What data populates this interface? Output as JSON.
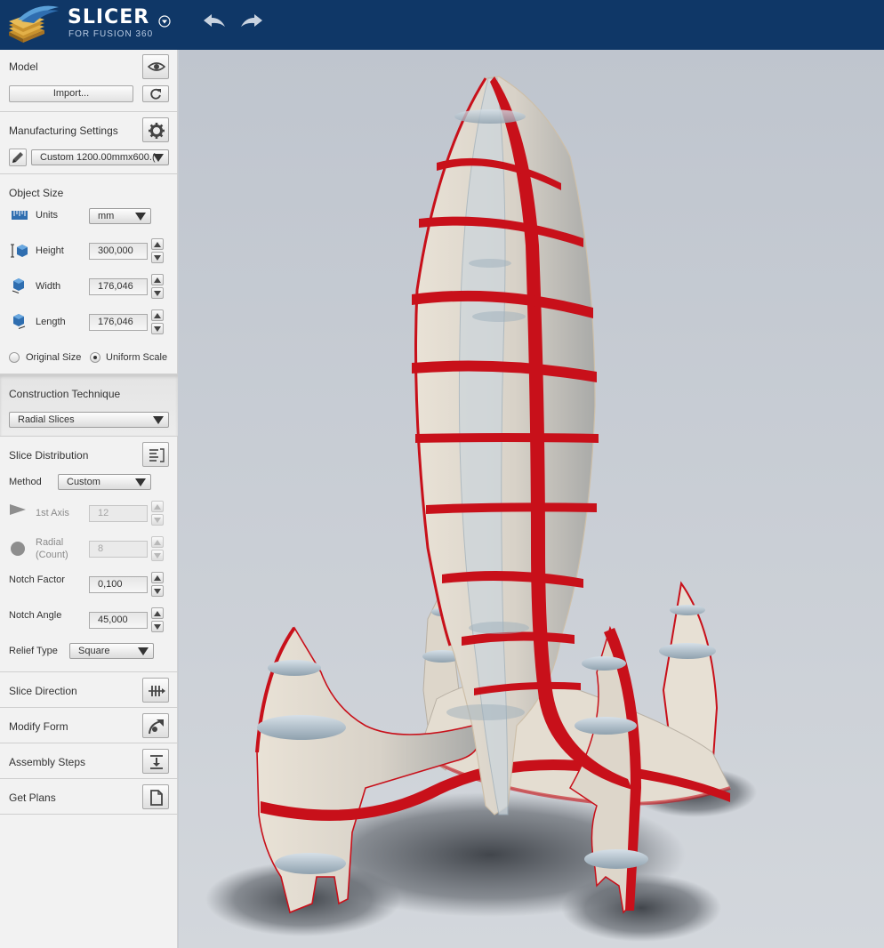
{
  "header": {
    "brand": "SLICER",
    "subtitle": "FOR FUSION 360"
  },
  "model": {
    "title": "Model",
    "import_label": "Import..."
  },
  "manufacturing": {
    "title": "Manufacturing Settings",
    "selected": "Custom 1200.00mmx600.("
  },
  "object_size": {
    "title": "Object Size",
    "units_label": "Units",
    "units_value": "mm",
    "height_label": "Height",
    "height_value": "300,000",
    "width_label": "Width",
    "width_value": "176,046",
    "length_label": "Length",
    "length_value": "176,046",
    "original_size_label": "Original Size",
    "uniform_scale_label": "Uniform Scale"
  },
  "construction": {
    "title": "Construction Technique",
    "selected": "Radial Slices"
  },
  "slice_distribution": {
    "title": "Slice Distribution",
    "method_label": "Method",
    "method_value": "Custom",
    "axis_label": "1st Axis",
    "axis_value": "12",
    "radial_label_1": "Radial",
    "radial_label_2": "(Count)",
    "radial_value": "8",
    "notch_factor_label": "Notch Factor",
    "notch_factor_value": "0,100",
    "notch_angle_label": "Notch Angle",
    "notch_angle_value": "45,000",
    "relief_type_label": "Relief Type",
    "relief_type_value": "Square"
  },
  "slice_direction": {
    "title": "Slice Direction"
  },
  "modify_form": {
    "title": "Modify Form"
  },
  "assembly_steps": {
    "title": "Assembly Steps"
  },
  "get_plans": {
    "title": "Get Plans"
  },
  "colors": {
    "header_bg": "#0f3767",
    "slice_red": "#c8101a",
    "sheet_beige": "#e7e0d4",
    "viewport_bg": "#c7ccd4"
  }
}
